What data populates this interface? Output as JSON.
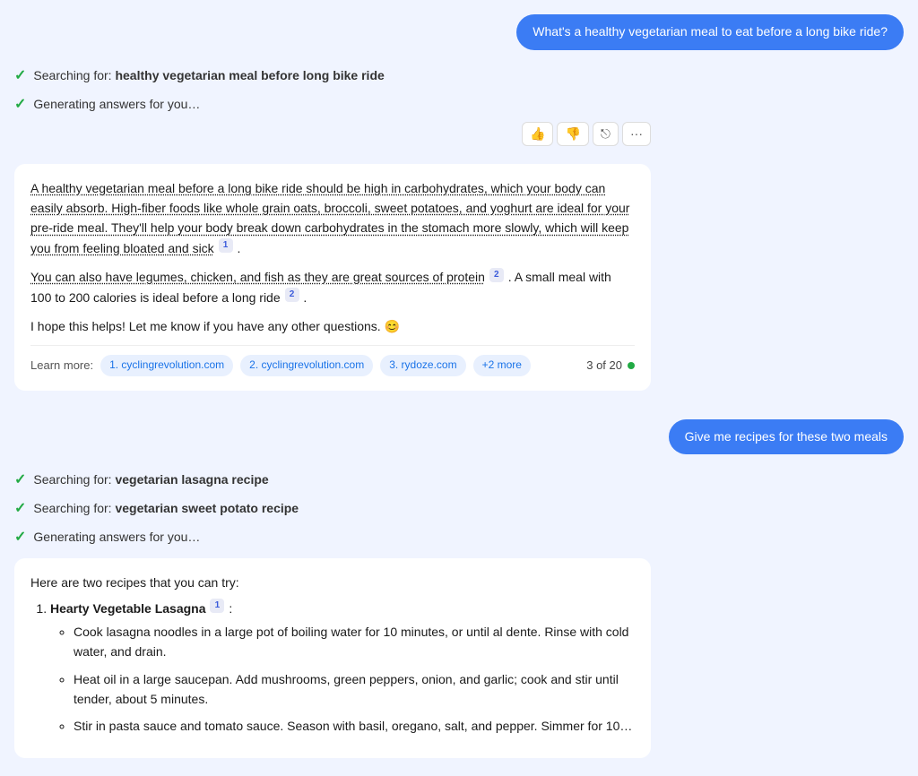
{
  "userMessages": [
    {
      "id": "user-msg-1",
      "text": "What's a healthy vegetarian meal to eat before a long bike ride?"
    },
    {
      "id": "user-msg-2",
      "text": "Give me recipes for these two meals"
    }
  ],
  "statusMessages": [
    {
      "id": "s1",
      "text": "Searching for: ",
      "bold": "healthy vegetarian meal before long bike ride"
    },
    {
      "id": "s2",
      "text": "Generating answers for you…",
      "bold": ""
    },
    {
      "id": "s3",
      "text": "Searching for: ",
      "bold": "vegetarian lasagna recipe"
    },
    {
      "id": "s4",
      "text": "Searching for: ",
      "bold": "vegetarian sweet potato recipe"
    },
    {
      "id": "s5",
      "text": "Generating answers for you…",
      "bold": ""
    }
  ],
  "toolbar": {
    "like": "👍",
    "dislike": "👎",
    "share": "⎋",
    "more": "···"
  },
  "answerCard1": {
    "para1": "A healthy vegetarian meal before a long bike ride should be high in carbohydrates, which your body can easily absorb. High-fiber foods like whole grain oats, broccoli, sweet potatoes, and yoghurt are ideal for your pre-ride meal. They'll help your body break down carbohydrates in the stomach more slowly, which will keep you from feeling bloated and sick",
    "cite1": "1",
    "para2": "You can also have legumes, chicken, and fish as they are great sources of protein",
    "cite2": "2",
    "para2b": ". A small meal with 100 to 200 calories is ideal before a long ride",
    "cite3": "2",
    "para3": "I hope this helps! Let me know if you have any other questions. 😊",
    "learnMore": "Learn more:",
    "links": [
      {
        "label": "1. cyclingrevolution.com"
      },
      {
        "label": "2. cyclingrevolution.com"
      },
      {
        "label": "3. rydoze.com"
      }
    ],
    "moreLinkLabel": "+2 more",
    "pageIndicator": "3 of 20"
  },
  "recipeCard": {
    "intro": "Here are two recipes that you can try:",
    "recipe1Title": "Hearty Vegetable Lasagna",
    "recipe1Cite": "1",
    "recipe1Steps": [
      "Cook lasagna noodles in a large pot of boiling water for 10 minutes, or until al dente. Rinse with cold water, and drain.",
      "Heat oil in a large saucepan. Add mushrooms, green peppers, onion, and garlic; cook and stir until tender, about 5 minutes.",
      "Stir in pasta sauce and tomato sauce. Season with basil, oregano, salt, and pepper. Simmer for 10…"
    ]
  }
}
